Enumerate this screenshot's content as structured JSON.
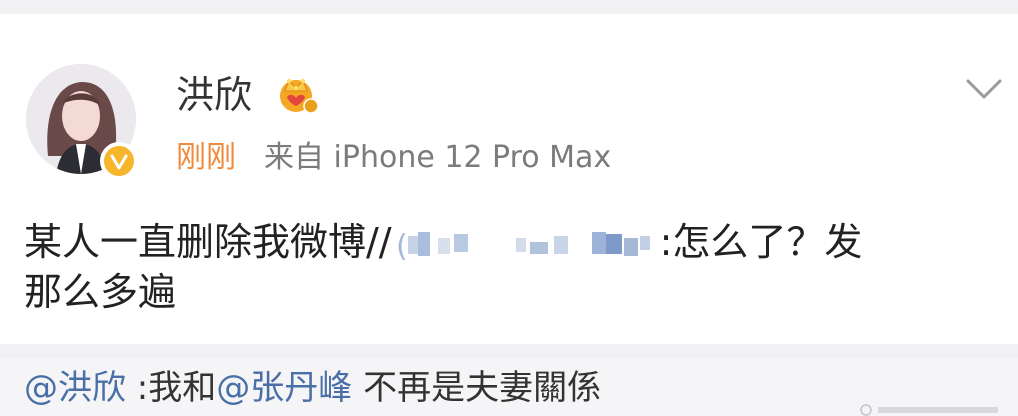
{
  "post": {
    "author": "洪欣",
    "time": "刚刚",
    "source": "来自 iPhone 12 Pro Max",
    "text_before": "某人一直删除我微博//",
    "text_after": ":怎么了？发",
    "text_line2": "那么多遍",
    "repost": {
      "mention1": "@洪欣",
      "text1": " :我和",
      "mention2": "@张丹峰",
      "text2": " 不再是夫妻關係"
    }
  },
  "icons": [
    "avatar",
    "verified-badge-icon",
    "crown-badge-icon",
    "chevron-down-icon"
  ],
  "colors": {
    "time": "#f08a3a",
    "mention": "#4a6fa6",
    "verified": "#f6b52a"
  }
}
